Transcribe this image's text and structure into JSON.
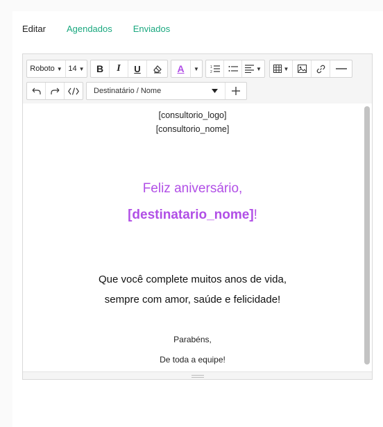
{
  "colors": {
    "accent": "#1aa87f",
    "purple": "#b14fe6",
    "text": "#222222"
  },
  "tabs": [
    {
      "label": "Editar",
      "active": true
    },
    {
      "label": "Agendados",
      "active": false
    },
    {
      "label": "Enviados",
      "active": false
    }
  ],
  "toolbar": {
    "font_family": "Roboto",
    "font_size": "14",
    "bold": "B",
    "italic": "I",
    "underline": "U",
    "font_color": "A",
    "placeholder_select": "Destinatário / Nome",
    "icons": [
      "eraser-icon",
      "ordered-list-icon",
      "unordered-list-icon",
      "align-icon",
      "table-icon",
      "image-icon",
      "link-icon",
      "horizontal-rule-icon",
      "undo-icon",
      "redo-icon",
      "code-view-icon",
      "plus-icon"
    ]
  },
  "document": {
    "logo_tag": "[consultorio_logo]",
    "name_tag": "[consultorio_nome]",
    "greeting": "Feliz aniversário,",
    "recipient_tag": "[destinatario_nome]",
    "recipient_suffix": "!",
    "message_line1": "Que você complete muitos anos de vida,",
    "message_line2": "sempre com amor, saúde e felicidade!",
    "closing1": "Parabéns,",
    "closing2": "De toda a equipe!"
  }
}
